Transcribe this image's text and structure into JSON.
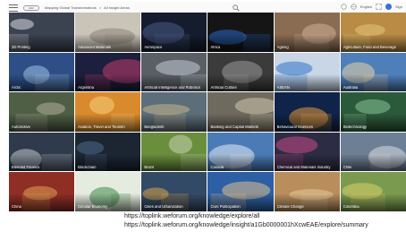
{
  "topbar": {
    "logo_text": "WEF",
    "crumb_1": "Mapping Global Transformations",
    "crumb_sep": ">",
    "crumb_2": "All Insight Areas",
    "language": "English",
    "signin": "Sign"
  },
  "tiles": [
    {
      "label": "3D Printing",
      "bg": "#3b4250",
      "accent": "#d9dde3"
    },
    {
      "label": "Advanced Materials",
      "bg": "#c9c3b8",
      "accent": "#8d8478"
    },
    {
      "label": "Aerospace",
      "bg": "#151c2e",
      "accent": "#4a5b86"
    },
    {
      "label": "Africa",
      "bg": "#151515",
      "accent": "#2a67c9"
    },
    {
      "label": "Ageing",
      "bg": "#8a6c52",
      "accent": "#d1b196"
    },
    {
      "label": "Agriculture, Food and Beverage",
      "bg": "#b98b45",
      "accent": "#e6c77d"
    },
    {
      "label": "Arctic",
      "bg": "#2d4f86",
      "accent": "#9fc3e8"
    },
    {
      "label": "Argentina",
      "bg": "#1c1f3d",
      "accent": "#c23b6d"
    },
    {
      "label": "Artificial Intelligence and Robotics",
      "bg": "#5a5f66",
      "accent": "#c5cad1"
    },
    {
      "label": "Artificial Culture",
      "bg": "#3b3b3b",
      "accent": "#9a9a9a"
    },
    {
      "label": "ASEAN",
      "bg": "#c8d6e6",
      "accent": "#2f74c9"
    },
    {
      "label": "Australia",
      "bg": "#4f7fb9",
      "accent": "#e9d4a8"
    },
    {
      "label": "Automotive",
      "bg": "#4e5f45",
      "accent": "#b3ad9c"
    },
    {
      "label": "Aviation, Travel and Tourism",
      "bg": "#d98a2d",
      "accent": "#f5d17a"
    },
    {
      "label": "Bangladesh",
      "bg": "#5b6e7a",
      "accent": "#c7b48a"
    },
    {
      "label": "Banking and Capital Markets",
      "bg": "#6f6a5e",
      "accent": "#cfc7b1"
    },
    {
      "label": "Behavioural Sciences",
      "bg": "#102348",
      "accent": "#e69a3a"
    },
    {
      "label": "Biotechnology",
      "bg": "#2b5a3a",
      "accent": "#86c297"
    },
    {
      "label": "Blended Finance",
      "bg": "#2f3b4d",
      "accent": "#c3c8cf"
    },
    {
      "label": "Blockchain",
      "bg": "#1c2633",
      "accent": "#4f6a89"
    },
    {
      "label": "Brazil",
      "bg": "#6a8f3c",
      "accent": "#c9d2b2"
    },
    {
      "label": "Canada",
      "bg": "#4a7bb6",
      "accent": "#e6edf4"
    },
    {
      "label": "Chemical and Materials Industry",
      "bg": "#2c2c44",
      "accent": "#c84b8a"
    },
    {
      "label": "Chile",
      "bg": "#6d7f94",
      "accent": "#d7dde2"
    },
    {
      "label": "China",
      "bg": "#8f2e25",
      "accent": "#e0a253"
    },
    {
      "label": "Circular Economy",
      "bg": "#e6ebe0",
      "accent": "#3e8a46"
    },
    {
      "label": "Cities and Urbanization",
      "bg": "#334a66",
      "accent": "#d9a54a"
    },
    {
      "label": "Civic Participation",
      "bg": "#2c5fa3",
      "accent": "#e2c08e"
    },
    {
      "label": "Climate Change",
      "bg": "#b98e5d",
      "accent": "#e7c99b"
    },
    {
      "label": "Colombia",
      "bg": "#7a9b4f",
      "accent": "#d8d06a"
    }
  ],
  "urls": [
    "https://toplink.weforum.org/knowledge/explore/all",
    "https://toplink.weforum.org/knowledge/insight/a1Gb0000001hXcwEAE/explore/summary"
  ]
}
